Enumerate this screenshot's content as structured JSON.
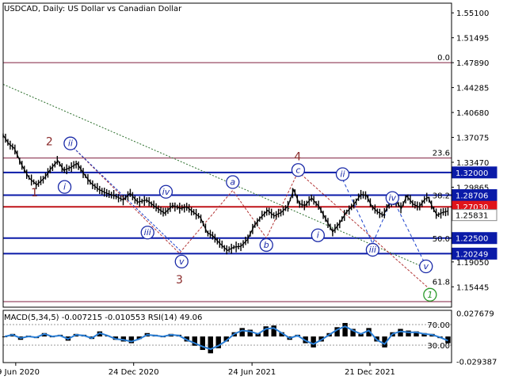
{
  "chart_data": [
    {
      "type": "candlestick",
      "title": "USDCAD, Daily:  US Dollar vs Canadian Dollar",
      "y_axis_side": "right",
      "ylim": [
        1.125,
        1.565
      ],
      "y_ticks": [
        "1.55100",
        "1.51495",
        "1.47890",
        "1.44285",
        "1.40680",
        "1.37075",
        "1.33470",
        "1.29865",
        "1.26260",
        "1.22655",
        "1.19050",
        "1.15445"
      ],
      "x_ticks": [
        {
          "label": "29 Jun 2020",
          "t": 0.028
        },
        {
          "label": "24 Dec 2020",
          "t": 0.291
        },
        {
          "label": "24 Jun 2021",
          "t": 0.555
        },
        {
          "label": "21 Dec 2021",
          "t": 0.818
        }
      ],
      "price_path": [
        [
          0,
          1.374
        ],
        [
          0.012,
          1.362
        ],
        [
          0.025,
          1.355
        ],
        [
          0.042,
          1.33
        ],
        [
          0.058,
          1.312
        ],
        [
          0.075,
          1.302
        ],
        [
          0.092,
          1.312
        ],
        [
          0.107,
          1.326
        ],
        [
          0.122,
          1.337
        ],
        [
          0.135,
          1.323
        ],
        [
          0.15,
          1.327
        ],
        [
          0.165,
          1.333
        ],
        [
          0.18,
          1.318
        ],
        [
          0.195,
          1.305
        ],
        [
          0.212,
          1.296
        ],
        [
          0.23,
          1.29
        ],
        [
          0.25,
          1.286
        ],
        [
          0.268,
          1.28
        ],
        [
          0.283,
          1.29
        ],
        [
          0.3,
          1.277
        ],
        [
          0.32,
          1.28
        ],
        [
          0.34,
          1.27
        ],
        [
          0.36,
          1.261
        ],
        [
          0.378,
          1.272
        ],
        [
          0.395,
          1.268
        ],
        [
          0.41,
          1.27
        ],
        [
          0.425,
          1.262
        ],
        [
          0.44,
          1.255
        ],
        [
          0.455,
          1.233
        ],
        [
          0.468,
          1.228
        ],
        [
          0.482,
          1.218
        ],
        [
          0.5,
          1.207
        ],
        [
          0.515,
          1.212
        ],
        [
          0.53,
          1.213
        ],
        [
          0.545,
          1.223
        ],
        [
          0.56,
          1.243
        ],
        [
          0.575,
          1.255
        ],
        [
          0.59,
          1.265
        ],
        [
          0.605,
          1.257
        ],
        [
          0.62,
          1.262
        ],
        [
          0.635,
          1.271
        ],
        [
          0.648,
          1.295
        ],
        [
          0.66,
          1.275
        ],
        [
          0.673,
          1.272
        ],
        [
          0.688,
          1.283
        ],
        [
          0.705,
          1.27
        ],
        [
          0.72,
          1.252
        ],
        [
          0.735,
          1.234
        ],
        [
          0.75,
          1.246
        ],
        [
          0.765,
          1.262
        ],
        [
          0.78,
          1.272
        ],
        [
          0.798,
          1.288
        ],
        [
          0.81,
          1.287
        ],
        [
          0.822,
          1.271
        ],
        [
          0.835,
          1.263
        ],
        [
          0.848,
          1.258
        ],
        [
          0.86,
          1.274
        ],
        [
          0.875,
          1.279
        ],
        [
          0.888,
          1.268
        ],
        [
          0.9,
          1.286
        ],
        [
          0.915,
          1.274
        ],
        [
          0.928,
          1.27
        ],
        [
          0.94,
          1.281
        ],
        [
          0.948,
          1.284
        ],
        [
          0.958,
          1.269
        ],
        [
          0.968,
          1.258
        ],
        [
          0.98,
          1.262
        ],
        [
          0.992,
          1.264
        ]
      ],
      "hlines": [
        {
          "y": 1.4789,
          "color": "#7f1f3f",
          "width": 1
        },
        {
          "y": 1.3409,
          "color": "#7f1f3f",
          "width": 1
        },
        {
          "y": 1.32,
          "color": "#0a1aa8",
          "width": 2
        },
        {
          "y": 1.2871,
          "color": "#0a1aa8",
          "width": 2
        },
        {
          "y": 1.2703,
          "color": "#c0141a",
          "width": 2
        },
        {
          "y": 1.225,
          "color": "#0a1aa8",
          "width": 2
        },
        {
          "y": 1.2025,
          "color": "#0a1aa8",
          "width": 2
        },
        {
          "y": 1.133,
          "color": "#7f1f3f",
          "width": 1
        }
      ],
      "fib_labels": [
        {
          "text": "0.0",
          "y": 1.4789
        },
        {
          "text": "23.6",
          "y": 1.3409
        },
        {
          "text": "38.2",
          "y": 1.279
        },
        {
          "text": "50.0",
          "y": 1.2165
        },
        {
          "text": "61.8",
          "y": 1.154
        }
      ],
      "price_boxes": [
        {
          "text": "1.32000",
          "y": 1.32,
          "bg": "#0a1aa8",
          "fg": "#ffffff"
        },
        {
          "text": "1.28706",
          "y": 1.2871,
          "bg": "#0a1aa8",
          "fg": "#ffffff"
        },
        {
          "text": "1.27030",
          "y": 1.2703,
          "bg": "#e0141a",
          "fg": "#ffffff"
        },
        {
          "text": "1.25831",
          "y": 1.2583,
          "bg": "#ffffff",
          "fg": "#000000"
        },
        {
          "text": "1.22500",
          "y": 1.225,
          "bg": "#0a1aa8",
          "fg": "#ffffff"
        },
        {
          "text": "1.20249",
          "y": 1.2025,
          "bg": "#0a1aa8",
          "fg": "#ffffff"
        }
      ],
      "wave_labels_major": [
        {
          "text": "2",
          "t": 0.103,
          "y": 1.365
        },
        {
          "text": "1",
          "t": 0.07,
          "y": 1.291
        },
        {
          "text": "4",
          "t": 0.657,
          "y": 1.343
        },
        {
          "text": "3",
          "t": 0.393,
          "y": 1.165
        }
      ],
      "wave_labels_circled": [
        {
          "text": "ii",
          "t": 0.15,
          "y": 1.362
        },
        {
          "text": "i",
          "t": 0.137,
          "y": 1.299
        },
        {
          "text": "iv",
          "t": 0.363,
          "y": 1.292
        },
        {
          "text": "iii",
          "t": 0.322,
          "y": 1.233
        },
        {
          "text": "v",
          "t": 0.398,
          "y": 1.191
        },
        {
          "text": "a",
          "t": 0.512,
          "y": 1.306
        },
        {
          "text": "b",
          "t": 0.587,
          "y": 1.215
        },
        {
          "text": "c",
          "t": 0.658,
          "y": 1.3235
        },
        {
          "text": "ii",
          "t": 0.757,
          "y": 1.3175
        },
        {
          "text": "i",
          "t": 0.702,
          "y": 1.229
        },
        {
          "text": "iv",
          "t": 0.868,
          "y": 1.283
        },
        {
          "text": "iii",
          "t": 0.824,
          "y": 1.208
        },
        {
          "text": "v",
          "t": 0.943,
          "y": 1.184
        },
        {
          "text": "1",
          "t": 0.952,
          "y": 1.143
        }
      ],
      "dotted_paths": [
        {
          "color": "#2a6e2a",
          "dash": "2,2",
          "points": [
            [
              0,
              1.4475
            ],
            [
              0.955,
              1.178
            ]
          ]
        },
        {
          "color": "#b33535",
          "dash": "3,2",
          "points": [
            [
              0.15,
              1.36
            ],
            [
              0.393,
              1.203
            ],
            [
              0.512,
              1.294
            ],
            [
              0.587,
              1.225
            ],
            [
              0.658,
              1.321
            ],
            [
              0.955,
              1.149
            ]
          ]
        },
        {
          "color": "#1a40cc",
          "dash": "3,2",
          "points": [
            [
              0.15,
              1.36
            ],
            [
              0.398,
              1.205
            ]
          ]
        },
        {
          "color": "#1a40cc",
          "dash": "4,3",
          "points": [
            [
              0.757,
              1.31
            ],
            [
              0.824,
              1.217
            ],
            [
              0.868,
              1.283
            ],
            [
              0.943,
              1.185
            ]
          ]
        }
      ]
    },
    {
      "type": "line",
      "title": "MACD(5,34,5) -0.007215 -0.010553 RSI(14) 49.06",
      "y_axis_side": "right",
      "ylim": [
        -0.031,
        0.031
      ],
      "y_ticks": [
        "0.027679",
        "-0.029387"
      ],
      "rsi_levels": [
        "70.00",
        "30.00"
      ],
      "series": [
        {
          "name": "MACD",
          "color": "#000000",
          "values": [
            0.0,
            0.003,
            -0.004,
            0.001,
            -0.002,
            0.004,
            -0.001,
            0.002,
            -0.005,
            0.003,
            0.002,
            -0.003,
            0.006,
            0.001,
            -0.004,
            -0.006,
            -0.008,
            -0.003,
            0.004,
            0.002,
            -0.001,
            0.003,
            0.002,
            -0.006,
            -0.011,
            -0.016,
            -0.02,
            -0.014,
            -0.006,
            0.005,
            0.01,
            0.008,
            0.004,
            0.012,
            0.013,
            0.005,
            -0.004,
            0.002,
            -0.008,
            -0.013,
            -0.006,
            0.004,
            0.011,
            0.016,
            0.009,
            0.003,
            0.01,
            -0.006,
            -0.013,
            0.005,
            0.009,
            0.007,
            0.006,
            0.004,
            0.003,
            -0.002,
            -0.008
          ]
        },
        {
          "name": "Signal",
          "color": "#2b7fd6",
          "values": [
            0.0,
            0.002,
            -0.002,
            0.0,
            -0.001,
            0.003,
            0.0,
            0.001,
            -0.003,
            0.002,
            0.001,
            -0.002,
            0.004,
            0.001,
            -0.003,
            -0.004,
            -0.006,
            -0.003,
            0.002,
            0.001,
            0.0,
            0.002,
            0.001,
            -0.004,
            -0.008,
            -0.012,
            -0.015,
            -0.011,
            -0.005,
            0.003,
            0.007,
            0.006,
            0.003,
            0.009,
            0.01,
            0.004,
            -0.002,
            0.001,
            -0.005,
            -0.009,
            -0.004,
            0.002,
            0.008,
            0.012,
            0.007,
            0.003,
            0.007,
            -0.004,
            -0.009,
            0.003,
            0.006,
            0.005,
            0.005,
            0.003,
            0.002,
            -0.001,
            -0.005
          ]
        }
      ]
    }
  ]
}
